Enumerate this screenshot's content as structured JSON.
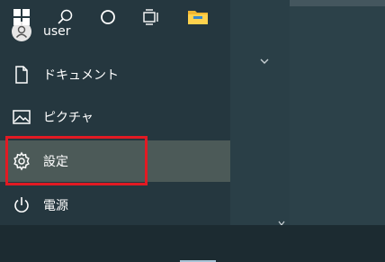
{
  "start_menu": {
    "items": [
      {
        "label": "user",
        "icon": "user-avatar-icon"
      },
      {
        "label": "ドキュメント",
        "icon": "document-icon"
      },
      {
        "label": "ピクチャ",
        "icon": "pictures-icon"
      },
      {
        "label": "設定",
        "icon": "gear-icon"
      },
      {
        "label": "電源",
        "icon": "power-icon"
      }
    ]
  },
  "taskbar": {
    "buttons": [
      {
        "icon": "windows-logo-icon"
      },
      {
        "icon": "search-icon"
      },
      {
        "icon": "cortana-icon"
      },
      {
        "icon": "task-view-icon"
      },
      {
        "icon": "file-explorer-icon"
      }
    ]
  },
  "colors": {
    "highlight_border": "#e21a23",
    "hover_background": "#4c5a58",
    "taskbar_background": "#1c2b31"
  }
}
